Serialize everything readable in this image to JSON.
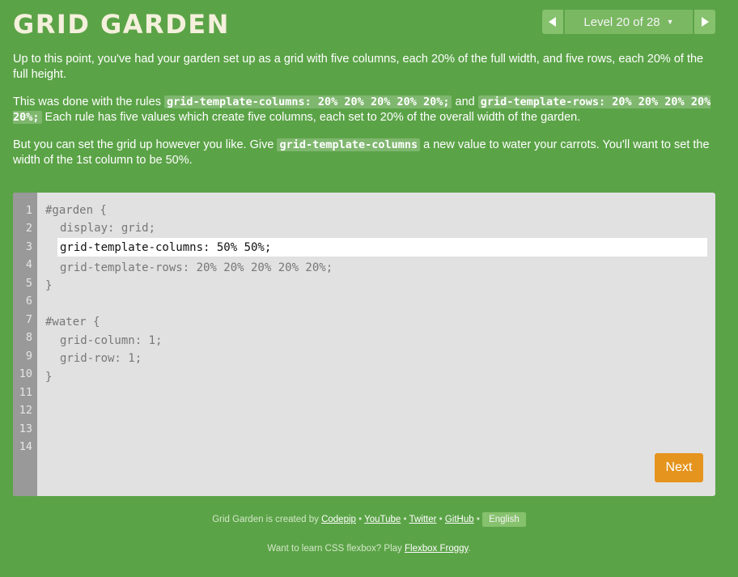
{
  "header": {
    "title": "GRID GARDEN"
  },
  "level_nav": {
    "label": "Level 20 of 28",
    "prev_icon": "triangle-left",
    "next_icon": "triangle-right",
    "caret_icon": "caret-down"
  },
  "instructions": {
    "p1": "Up to this point, you've had your garden set up as a grid with five columns, each 20% of the full width, and five rows, each 20% of the full height.",
    "p2_a": "This was done with the rules ",
    "p2_code1": "grid-template-columns: 20% 20% 20% 20% 20%;",
    "p2_b": " and ",
    "p2_code2": "grid-template-rows: 20% 20% 20% 20% 20%;",
    "p2_c": " Each rule has five values which create five columns, each set to 20% of the overall width of the garden.",
    "p3_a": "But you can set the grid up however you like. Give ",
    "p3_code": "grid-template-columns",
    "p3_b": " a new value to water your carrots. You'll want to set the width of the 1st column to be 50%."
  },
  "editor": {
    "line_numbers": [
      "1",
      "2",
      "3",
      "4",
      "5",
      "6",
      "7",
      "8",
      "9",
      "10",
      "11",
      "12",
      "13",
      "14"
    ],
    "lines": {
      "l1": "#garden {",
      "l2": "display: grid;",
      "l4": "grid-template-rows: 20% 20% 20% 20% 20%;",
      "l5": "}",
      "l7": "#water {",
      "l8": "grid-column: 1;",
      "l9": "grid-row: 1;",
      "l10": "}"
    },
    "input_value": "grid-template-columns: 50% 50%;",
    "next_label": "Next"
  },
  "footer": {
    "credit_prefix": "Grid Garden is created by ",
    "links": {
      "codepip": "Codepip",
      "youtube": "YouTube",
      "twitter": "Twitter",
      "github": "GitHub"
    },
    "separator": " • ",
    "language": "English",
    "promo_prefix": "Want to learn CSS flexbox? Play ",
    "promo_link": "Flexbox Froggy",
    "promo_suffix": "."
  },
  "colors": {
    "background": "#5ba347",
    "editor_bg": "#e1e1e1",
    "gutter": "#999999",
    "next_button": "#e5941e",
    "nav": "#86c16d"
  }
}
